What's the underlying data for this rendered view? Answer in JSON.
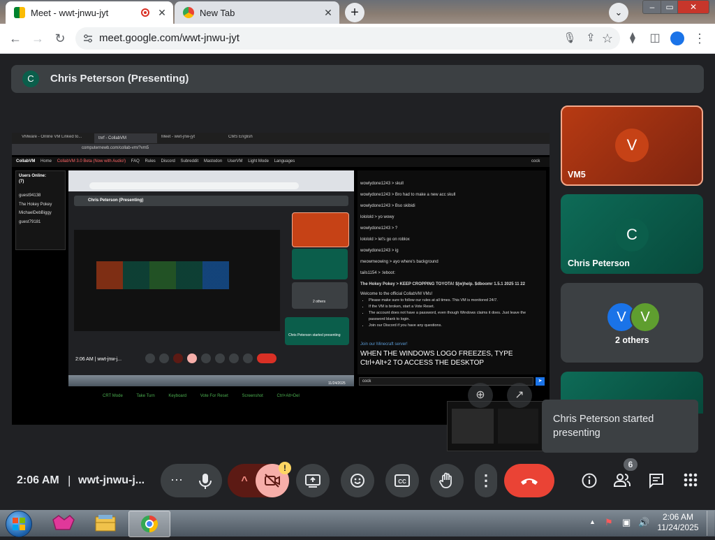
{
  "browser": {
    "tabs": [
      {
        "title": "Meet - wwt-jnwu-jyt",
        "recording": true
      },
      {
        "title": "New Tab"
      }
    ],
    "new_tab": "+",
    "tab_search": "⌄",
    "window_controls": [
      "–",
      "▭",
      "✕"
    ],
    "url": "meet.google.com/wwt-jnwu-jyt"
  },
  "meet": {
    "presenter_initial": "C",
    "presenter_banner": "Chris Peterson (Presenting)",
    "participants": [
      {
        "initial": "V",
        "name": "VM5",
        "color": "#c64216"
      },
      {
        "initial": "C",
        "name": "Chris Peterson",
        "color": "#0b5e4b"
      }
    ],
    "others": {
      "initials": [
        "V",
        "V"
      ],
      "colors": [
        "#1a73e8",
        "#5f9e2f"
      ],
      "label": "2 others"
    },
    "toast": "Chris Peterson started presenting",
    "time": "2:06 AM",
    "separator": "|",
    "meeting_code": "wwt-jnwu-j...",
    "participant_count": "6",
    "camera_warning": "!"
  },
  "shared_screen": {
    "tabs": [
      "VMware - Online VM Linked to...",
      "tnrf - CollabVM",
      "Meet - wwt-jnw-jyt",
      "CMS English"
    ],
    "address": "computernewb.com/collab-vm/?vm5",
    "site_nav": [
      "CollabVM",
      "Home",
      "CollabVM 3.0 Beta (Now with Audio!)",
      "FAQ",
      "Rules",
      "Discord",
      "Subreddit",
      "Mastodon",
      "UserVM",
      "Light Mode",
      "Languages"
    ],
    "user_menu": "cock",
    "users_title": "Users Online:",
    "users_count": "(7)",
    "users": [
      "guest94138",
      "The Hokey Pokey",
      "MichaelDebBiggy",
      "guest79181"
    ],
    "chat": [
      "wowlydone1243 > skull",
      "wowlydone1243 > Bro had to make a new acc skull",
      "wowlydone1243 > Bso skibidi",
      "lololold > yo wowy",
      "wowlydone1243 > ?",
      "lololold > let's go on roblox",
      "wowlydone1243 > ig",
      "meowmeowing > ayo where's background",
      "tails1154 > :leboot:",
      "The Hokey Pokey > KEEP CROPPING TOYOTA! $(w)help. $dboomr 1.5.1 2025 11 22"
    ],
    "welcome": "Welcome to the official CollabVM VMs!",
    "rules_list": [
      "Please make sure to follow our rules at all times. This VM is monitored 24/7.",
      "If the VM is broken, start a Vote Reset.",
      "The account does not have a password, even though Windows claims it does. Just leave the password blank to login.",
      "Join our Discord if you have any questions."
    ],
    "minecraft_link": "Join our Minecraft server!",
    "notice": "WHEN THE WINDOWS LOGO FREEZES, TYPE Ctrl+Alt+2 TO ACCESS THE DESKTOP",
    "chat_input": "cock",
    "bottom_links": [
      "CRT Mode",
      "Take Turn",
      "Keyboard",
      "Vote For Reset",
      "Screenshot",
      "Ctrl+Alt+Del"
    ],
    "inner_meet_banner": "Chris Peterson (Presenting)",
    "inner_meet_time": "2:06 AM",
    "inner_meet_code": "wwt-jnw-j...",
    "inner_toast": "Chris Peterson started presenting",
    "inner_others": "2 others",
    "inner_date": "11/24/2025"
  },
  "taskbar": {
    "time": "2:06 AM",
    "date": "11/24/2025",
    "tray": [
      "▲",
      "⚑",
      "▣",
      "🔊"
    ]
  }
}
